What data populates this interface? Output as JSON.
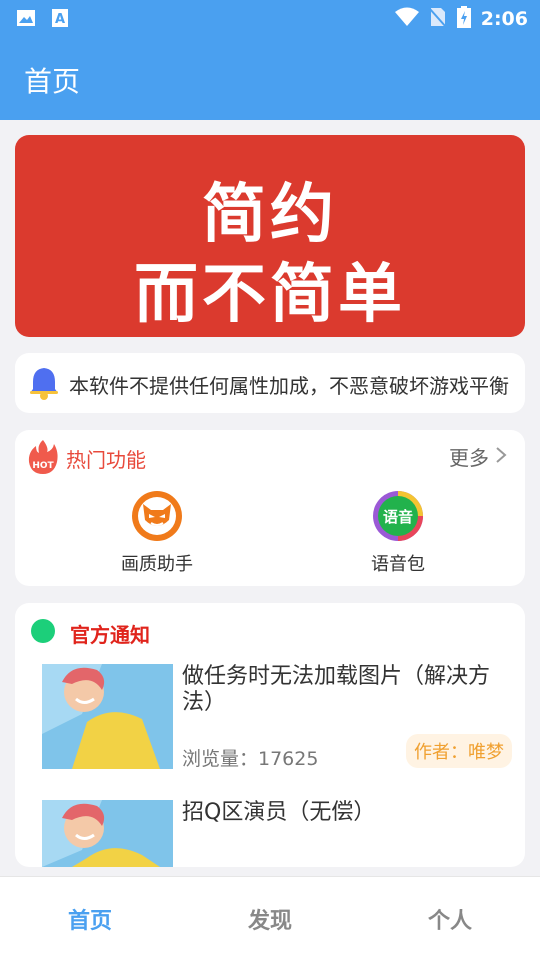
{
  "status_bar": {
    "time": "2:06"
  },
  "app_bar": {
    "title": "首页"
  },
  "banner": {
    "line1": "简约",
    "line2": "而不简单"
  },
  "notice": {
    "text": "本软件不提供任何属性加成，不恶意破坏游戏平衡"
  },
  "hot_section": {
    "title": "热门功能",
    "badge": "HOT",
    "more_label": "更多",
    "items": [
      {
        "label": "画质助手"
      },
      {
        "label": "语音包",
        "icon_text": "语音"
      }
    ]
  },
  "official_section": {
    "title": "官方通知",
    "news": [
      {
        "title": "做任务时无法加载图片（解决方法）",
        "views_label": "浏览量：17625",
        "author_label": "作者：唯梦"
      },
      {
        "title": "招Q区演员（无偿）"
      }
    ]
  },
  "tabs": [
    {
      "label": "首页",
      "active": true
    },
    {
      "label": "发现",
      "active": false
    },
    {
      "label": "个人",
      "active": false
    }
  ],
  "colors": {
    "primary": "#4aa0f0",
    "banner_red": "#db3a2e",
    "hot_red": "#e84a3c"
  }
}
